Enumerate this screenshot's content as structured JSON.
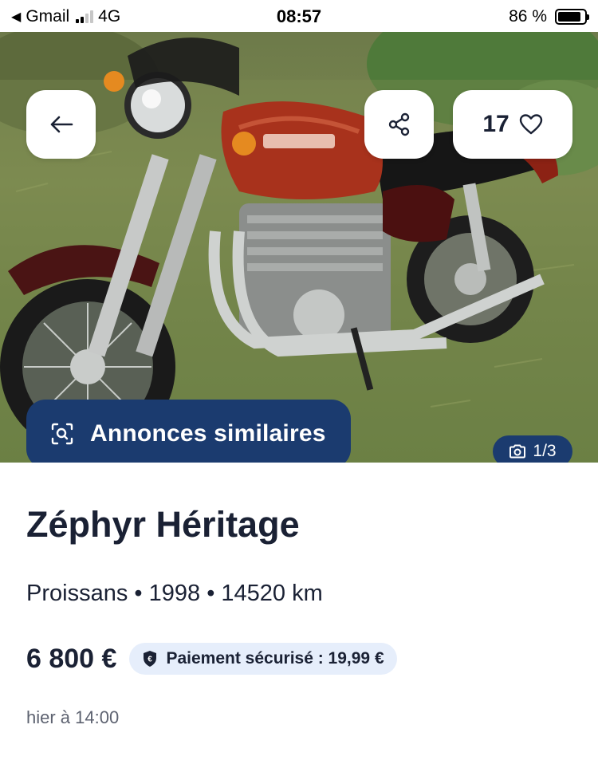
{
  "status_bar": {
    "back_app": "Gmail",
    "network": "4G",
    "time": "08:57",
    "battery": "86 %",
    "battery_level": 0.86
  },
  "photo": {
    "favorites_count": "17",
    "similar_label": "Annonces similaires",
    "counter": "1/3"
  },
  "listing": {
    "title": "Zéphyr Héritage",
    "location": "Proissans",
    "year": "1998",
    "mileage": "14520 km",
    "separator": "•",
    "price": "6 800 €",
    "secure_payment": "Paiement sécurisé : 19,99 €",
    "posted": "hier à 14:00"
  },
  "colors": {
    "accent": "#1b3b6f",
    "badge_bg": "#e6eefb",
    "text": "#1a2134"
  }
}
